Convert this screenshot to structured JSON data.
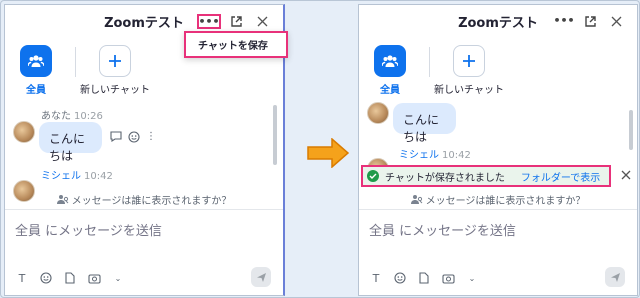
{
  "window": {
    "title": "Zoomテスト"
  },
  "quick_actions": {
    "everyone_label": "全員",
    "new_chat_label": "新しいチャット"
  },
  "left_panel": {
    "menu_item": "チャットを保存",
    "messages": [
      {
        "sender": "あなた",
        "time": "10:26",
        "text": "こんにちは"
      },
      {
        "sender": "ミシェル",
        "time": "10:42"
      }
    ]
  },
  "right_panel": {
    "messages": [
      {
        "text": "こんにちは"
      },
      {
        "sender": "ミシェル",
        "time": "10:42"
      }
    ],
    "toast": {
      "text": "チャットが保存されました",
      "link": "フォルダーで表示"
    }
  },
  "common": {
    "visibility_text": "メッセージは誰に表示されますか？",
    "input_placeholder": "全員 にメッセージを送信"
  },
  "colors": {
    "accent": "#0e72ed",
    "highlight": "#e8317a",
    "bubble": "#dceafd",
    "arrow": "#f5a21b"
  },
  "icons": {
    "more": "ellipsis-icon",
    "popout": "popout-icon",
    "close": "close-icon",
    "everyone": "people-icon",
    "new_chat": "plus-icon",
    "react": "reaction-icon",
    "success": "check-circle-icon",
    "format": "text-format-icon",
    "emoji": "emoji-icon",
    "file": "file-icon",
    "screenshot": "screenshot-icon",
    "send": "send-icon",
    "transition": "right-arrow-icon"
  }
}
